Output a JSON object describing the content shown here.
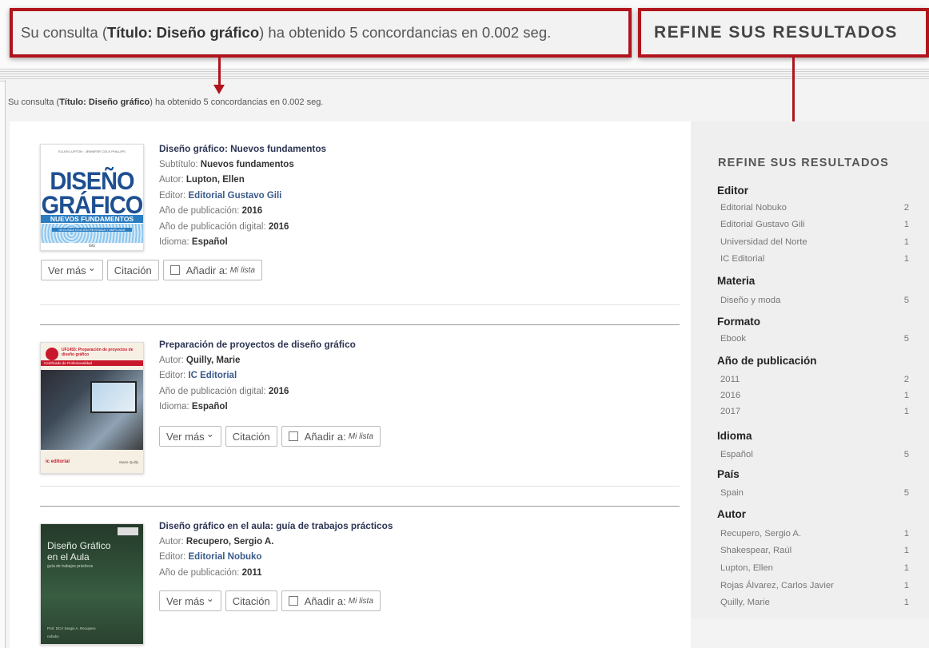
{
  "callout_query": {
    "pre": "Su consulta (",
    "bold": "Título: Diseño gráfico",
    "post": ") ha obtenido 5 concordancias en 0.002 seg."
  },
  "callout_refine": "REFINE SUS RESULTADOS",
  "query": {
    "pre": "Su consulta (",
    "bold": "Título: Diseño gráfico",
    "post": ") ha obtenido 5 concordancias en 0.002 seg."
  },
  "labels": {
    "subtitle": "Subtítulo: ",
    "author": "Autor: ",
    "editor": "Editor: ",
    "pub_year": "Año de publicación: ",
    "pub_digital": "Año de publicación digital: ",
    "language": "Idioma: "
  },
  "buttons": {
    "ver_mas": "Ver más",
    "citacion": "Citación",
    "anadir": "Añadir a:",
    "mi_lista": "Mi lista",
    "chevron": "⌄"
  },
  "results": [
    {
      "title": "Diseño gráfico: Nuevos fundamentos",
      "subtitle": "Nuevos fundamentos",
      "author": "Lupton, Ellen",
      "editor": "Editorial Gustavo Gili",
      "pub_year": "2016",
      "pub_digital": "2016",
      "language": "Español",
      "cover": {
        "top": "ELLEN LUPTON · JENNIFER COLE PHILLIPS",
        "line1": "DISEÑO",
        "line2": "GRÁFICO",
        "line3": "NUEVOS FUNDAMENTOS",
        "band": "SEGUNDA EDICIÓN REVISADA Y AMPLIADA",
        "publisher": "GG"
      }
    },
    {
      "title": "Preparación de proyectos de diseño gráfico",
      "author": "Quilly, Marie",
      "editor": "IC Editorial",
      "pub_digital": "2016",
      "language": "Español",
      "cover": {
        "code": "UF1455: Preparación de proyectos de diseño gráfico",
        "sub": "Certificado de Profesionalidad",
        "publisher": "ic editorial",
        "author_small": "Marie Quilly"
      }
    },
    {
      "title": "Diseño gráfico en el aula: guía de trabajos prácticos",
      "author": "Recupero, Sergio A.",
      "editor": "Editorial Nobuko",
      "pub_year": "2011",
      "cover": {
        "line1": "Diseño Gráfico",
        "line2": "en el Aula",
        "line3": "guía de trabajos prácticos",
        "author_small": "Prof. DCV Sergio A. Recupero",
        "publisher": "nobuko"
      }
    }
  ],
  "sidebar": {
    "title": "REFINE SUS RESULTADOS",
    "facets": [
      {
        "name": "Editor",
        "items": [
          {
            "label": "Editorial Nobuko",
            "count": "2"
          },
          {
            "label": "Editorial Gustavo Gili",
            "count": "1"
          },
          {
            "label": "Universidad del Norte",
            "count": "1"
          },
          {
            "label": "IC Editorial",
            "count": "1"
          }
        ]
      },
      {
        "name": "Materia",
        "items": [
          {
            "label": "Diseño y moda",
            "count": "5"
          }
        ]
      },
      {
        "name": "Formato",
        "items": [
          {
            "label": "Ebook",
            "count": "5"
          }
        ]
      },
      {
        "name": "Año de publicación",
        "items": [
          {
            "label": "2011",
            "count": "2"
          },
          {
            "label": "2016",
            "count": "1"
          },
          {
            "label": "2017",
            "count": "1"
          }
        ]
      },
      {
        "name": "Idioma",
        "items": [
          {
            "label": "Español",
            "count": "5"
          }
        ]
      },
      {
        "name": "País",
        "items": [
          {
            "label": "Spain",
            "count": "5"
          }
        ]
      },
      {
        "name": "Autor",
        "items": [
          {
            "label": "Recupero, Sergio A.",
            "count": "1"
          },
          {
            "label": "Shakespear, Raúl",
            "count": "1"
          },
          {
            "label": "Lupton, Ellen",
            "count": "1"
          },
          {
            "label": "Rojas Álvarez, Carlos Javier",
            "count": "1"
          },
          {
            "label": "Quilly, Marie",
            "count": "1"
          }
        ]
      }
    ]
  },
  "colors": {
    "callout_border": "#b0141d",
    "title": "#2c3553",
    "link": "#3a5a8a"
  }
}
